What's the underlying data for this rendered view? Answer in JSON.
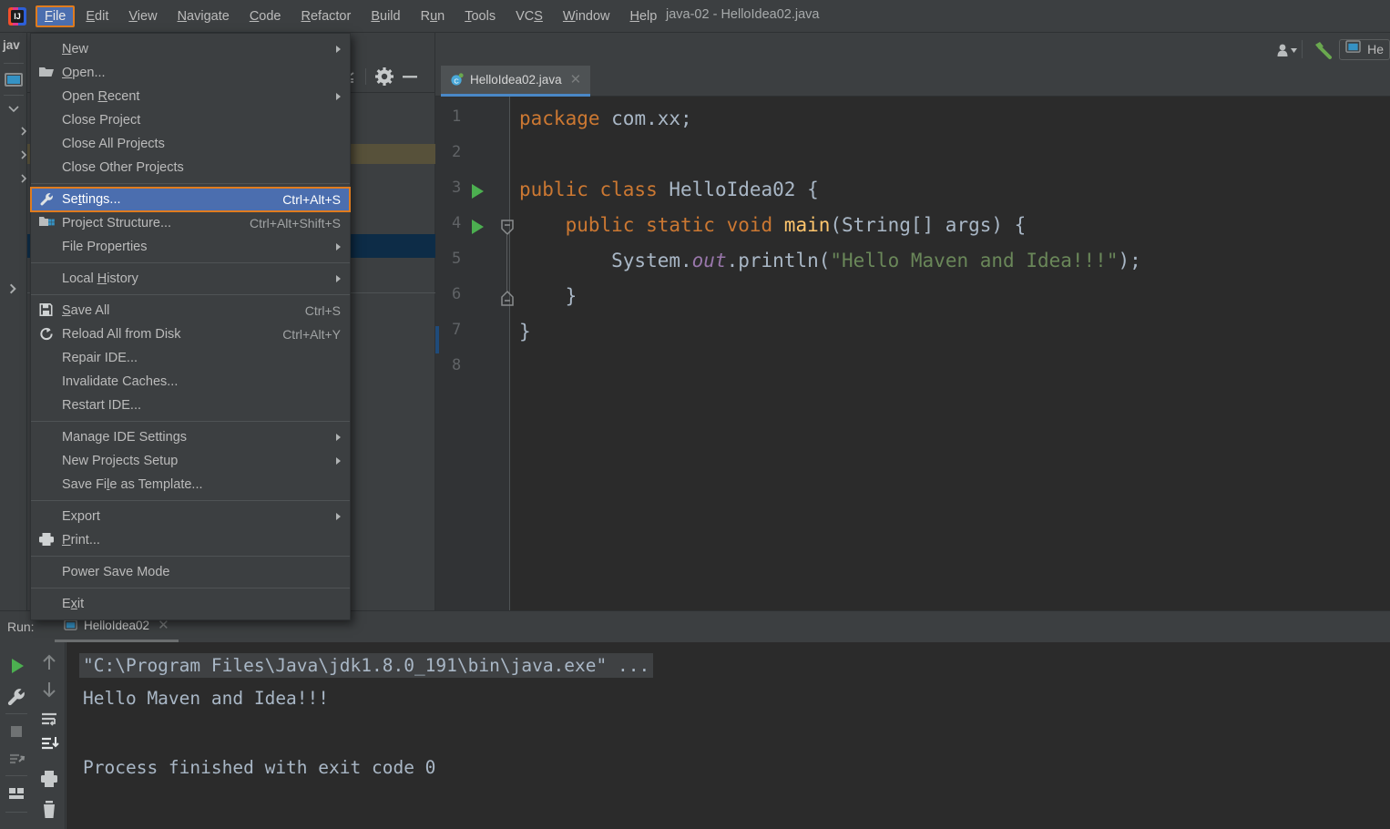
{
  "window": {
    "title": "java-02 - HelloIdea02.java",
    "logo_icon": "intellij-idea-logo"
  },
  "menubar": {
    "items": [
      {
        "label": "File",
        "mnemonic": "F",
        "active": true
      },
      {
        "label": "Edit",
        "mnemonic": "E",
        "active": false
      },
      {
        "label": "View",
        "mnemonic": "V",
        "active": false
      },
      {
        "label": "Navigate",
        "mnemonic": "N",
        "active": false
      },
      {
        "label": "Code",
        "mnemonic": "C",
        "active": false
      },
      {
        "label": "Refactor",
        "mnemonic": "R",
        "active": false
      },
      {
        "label": "Build",
        "mnemonic": "B",
        "active": false
      },
      {
        "label": "Run",
        "mnemonic": "u",
        "active": false
      },
      {
        "label": "Tools",
        "mnemonic": "T",
        "active": false
      },
      {
        "label": "VCS",
        "mnemonic": "S",
        "active": false
      },
      {
        "label": "Window",
        "mnemonic": "W",
        "active": false
      },
      {
        "label": "Help",
        "mnemonic": "H",
        "active": false
      }
    ]
  },
  "file_menu": {
    "open_menu": "File",
    "highlight_color": "#4b6eaf",
    "focus_border_color": "#e07c1e",
    "items": [
      {
        "label": "New",
        "mnemonic": "N",
        "icon": "",
        "shortcut": "",
        "submenu": true,
        "selected": false
      },
      {
        "label": "Open...",
        "mnemonic": "O",
        "icon": "folder-open-icon",
        "shortcut": "",
        "submenu": false,
        "selected": false
      },
      {
        "label": "Open Recent",
        "mnemonic": "R",
        "icon": "",
        "shortcut": "",
        "submenu": true,
        "selected": false
      },
      {
        "label": "Close Project",
        "mnemonic": "",
        "icon": "",
        "shortcut": "",
        "submenu": false,
        "selected": false
      },
      {
        "label": "Close All Projects",
        "mnemonic": "",
        "icon": "",
        "shortcut": "",
        "submenu": false,
        "selected": false
      },
      {
        "label": "Close Other Projects",
        "mnemonic": "",
        "icon": "",
        "shortcut": "",
        "submenu": false,
        "selected": false
      },
      {
        "separator": true
      },
      {
        "label": "Settings...",
        "mnemonic": "t",
        "icon": "wrench-icon",
        "shortcut": "Ctrl+Alt+S",
        "submenu": false,
        "selected": true
      },
      {
        "label": "Project Structure...",
        "mnemonic": "",
        "icon": "project-structure-icon",
        "shortcut": "Ctrl+Alt+Shift+S",
        "submenu": false,
        "selected": false
      },
      {
        "label": "File Properties",
        "mnemonic": "",
        "icon": "",
        "shortcut": "",
        "submenu": true,
        "selected": false
      },
      {
        "separator": true
      },
      {
        "label": "Local History",
        "mnemonic": "H",
        "icon": "",
        "shortcut": "",
        "submenu": true,
        "selected": false
      },
      {
        "separator": true
      },
      {
        "label": "Save All",
        "mnemonic": "S",
        "icon": "save-icon",
        "shortcut": "Ctrl+S",
        "submenu": false,
        "selected": false
      },
      {
        "label": "Reload All from Disk",
        "mnemonic": "",
        "icon": "reload-icon",
        "shortcut": "Ctrl+Alt+Y",
        "submenu": false,
        "selected": false
      },
      {
        "label": "Repair IDE...",
        "mnemonic": "",
        "icon": "",
        "shortcut": "",
        "submenu": false,
        "selected": false
      },
      {
        "label": "Invalidate Caches...",
        "mnemonic": "",
        "icon": "",
        "shortcut": "",
        "submenu": false,
        "selected": false
      },
      {
        "label": "Restart IDE...",
        "mnemonic": "",
        "icon": "",
        "shortcut": "",
        "submenu": false,
        "selected": false
      },
      {
        "separator": true
      },
      {
        "label": "Manage IDE Settings",
        "mnemonic": "",
        "icon": "",
        "shortcut": "",
        "submenu": true,
        "selected": false
      },
      {
        "label": "New Projects Setup",
        "mnemonic": "",
        "icon": "",
        "shortcut": "",
        "submenu": true,
        "selected": false
      },
      {
        "label": "Save File as Template...",
        "mnemonic": "l",
        "icon": "",
        "shortcut": "",
        "submenu": false,
        "selected": false
      },
      {
        "separator": true
      },
      {
        "label": "Export",
        "mnemonic": "",
        "icon": "",
        "shortcut": "",
        "submenu": true,
        "selected": false
      },
      {
        "label": "Print...",
        "mnemonic": "P",
        "icon": "print-icon",
        "shortcut": "",
        "submenu": false,
        "selected": false
      },
      {
        "separator": true
      },
      {
        "label": "Power Save Mode",
        "mnemonic": "",
        "icon": "",
        "shortcut": "",
        "submenu": false,
        "selected": false
      },
      {
        "separator": true
      },
      {
        "label": "Exit",
        "mnemonic": "x",
        "icon": "",
        "shortcut": "",
        "submenu": false,
        "selected": false
      }
    ]
  },
  "toolbar_right": {
    "user_icon": "user-dropdown-icon",
    "hammer_icon": "build-hammer-icon",
    "run_config_icon": "run-configuration-icon",
    "run_config_label": "He"
  },
  "left_strip": {
    "label": "jav"
  },
  "project_panel": {
    "toolbar_icons": [
      "collapse-all-icon",
      "gear-icon",
      "minimize-icon"
    ]
  },
  "editor": {
    "tab": {
      "label": "HelloIdea02.java",
      "icon": "java-class-icon",
      "close_icon": "close-icon",
      "active_underline_color": "#4a88c7"
    },
    "background": "#2b2b2b",
    "gutter_background": "#313335",
    "line_numbers": [
      "1",
      "2",
      "3",
      "4",
      "5",
      "6",
      "7",
      "8"
    ],
    "run_markers_on_lines": [
      3,
      4
    ],
    "fold_markers_on_lines": [
      4,
      6
    ],
    "lines": [
      {
        "n": 1,
        "tokens": [
          {
            "t": "package ",
            "c": "kw"
          },
          {
            "t": "com.xx;",
            "c": "pl"
          }
        ]
      },
      {
        "n": 2,
        "tokens": []
      },
      {
        "n": 3,
        "tokens": [
          {
            "t": "public class ",
            "c": "kw"
          },
          {
            "t": "HelloIdea02 {",
            "c": "pl"
          }
        ]
      },
      {
        "n": 4,
        "tokens": [
          {
            "t": "    public static void ",
            "c": "kw"
          },
          {
            "t": "main",
            "c": "fn"
          },
          {
            "t": "(String[] args) {",
            "c": "pl"
          }
        ]
      },
      {
        "n": 5,
        "tokens": [
          {
            "t": "        System.",
            "c": "pl"
          },
          {
            "t": "out",
            "c": "it"
          },
          {
            "t": ".println(",
            "c": "pl"
          },
          {
            "t": "\"Hello Maven and Idea!!!\"",
            "c": "st"
          },
          {
            "t": ");",
            "c": "pl"
          }
        ]
      },
      {
        "n": 6,
        "tokens": [
          {
            "t": "    }",
            "c": "pl"
          }
        ]
      },
      {
        "n": 7,
        "tokens": [
          {
            "t": "}",
            "c": "pl"
          }
        ]
      },
      {
        "n": 8,
        "tokens": []
      }
    ],
    "colors": {
      "keyword": "#cc7832",
      "plain": "#a9b7c6",
      "method": "#ffc66d",
      "string": "#6a8759",
      "static_field": "#9876aa",
      "line_number": "#606366"
    }
  },
  "run_panel": {
    "label": "Run:",
    "tab": {
      "label": "HelloIdea02",
      "icon": "run-config-icon",
      "close_icon": "close-icon"
    },
    "left_toolbar_icons": [
      "run-icon",
      "wrench-icon",
      "stop-icon",
      "rerun-failed-icon",
      "layout-icon"
    ],
    "right_toolbar_icons": [
      "up-arrow-icon",
      "down-arrow-icon",
      "soft-wrap-icon",
      "scroll-to-end-icon",
      "print-icon",
      "trash-icon"
    ],
    "selected_toolbar_icon": "scroll-to-end-icon",
    "console_lines": [
      {
        "text": "\"C:\\Program Files\\Java\\jdk1.8.0_191\\bin\\java.exe\" ...",
        "highlighted": true
      },
      {
        "text": "Hello Maven and Idea!!!",
        "highlighted": false
      },
      {
        "text": "",
        "highlighted": false
      },
      {
        "text": "Process finished with exit code 0",
        "highlighted": false
      }
    ]
  }
}
